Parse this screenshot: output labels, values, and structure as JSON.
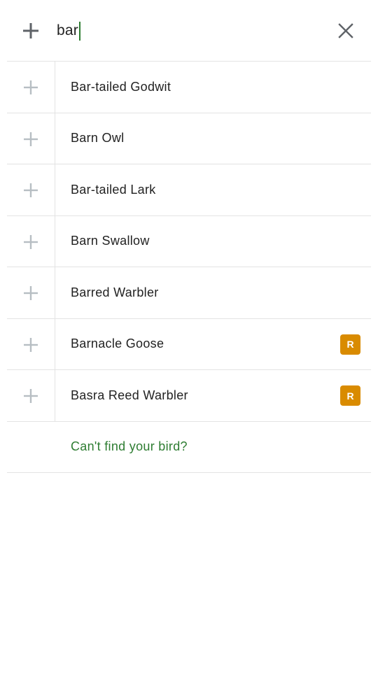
{
  "search": {
    "query": "bar"
  },
  "results": [
    {
      "name": "Bar-tailed Godwit",
      "badge": ""
    },
    {
      "name": "Barn Owl",
      "badge": ""
    },
    {
      "name": "Bar-tailed Lark",
      "badge": ""
    },
    {
      "name": "Barn Swallow",
      "badge": ""
    },
    {
      "name": "Barred Warbler",
      "badge": ""
    },
    {
      "name": "Barnacle Goose",
      "badge": "R"
    },
    {
      "name": "Basra Reed Warbler",
      "badge": "R"
    }
  ],
  "footer": {
    "cant_find_label": "Can't find your bird?"
  },
  "icons": {
    "header_add": "plus-icon",
    "clear": "close-icon",
    "row_add": "plus-icon"
  },
  "colors": {
    "accent_green": "#2e7d32",
    "badge_orange": "#d98b00",
    "icon_grey": "#5f6368",
    "row_plus_grey": "#b7bec3"
  }
}
